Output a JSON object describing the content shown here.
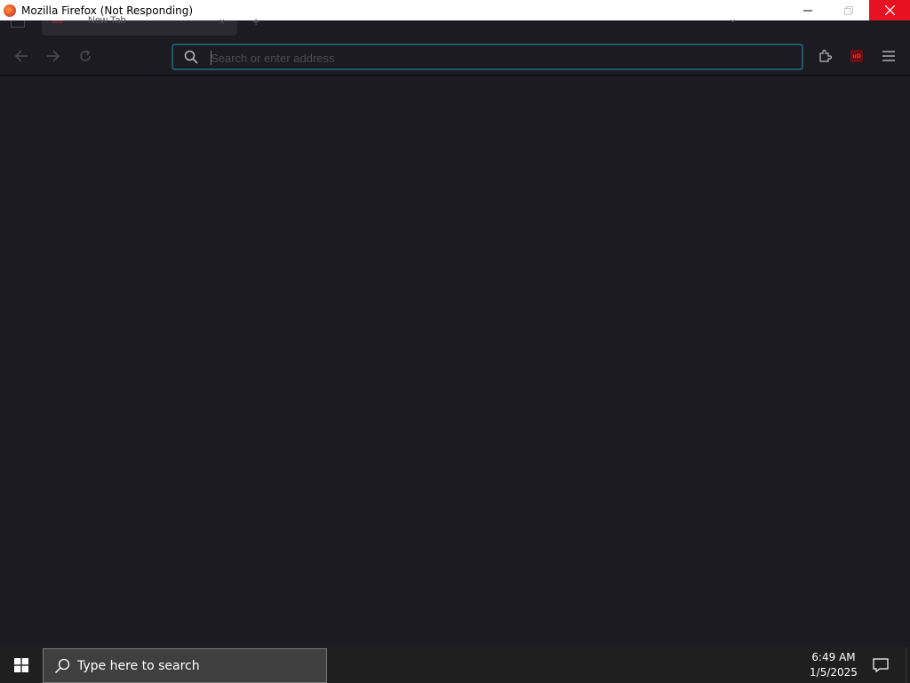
{
  "window": {
    "title": "Mozilla Firefox (Not Responding)",
    "controls": [
      "minimize-icon",
      "restore-icon",
      "close-icon"
    ],
    "close_color": "#e81123"
  },
  "browser": {
    "tab": {
      "label": "New Tab",
      "close": "×"
    },
    "new_tab_glyph": "+",
    "tablist_glyph": "⌄",
    "nav": {
      "back_icon": "arrow-left-icon",
      "forward_icon": "arrow-right-icon",
      "reload_icon": "reload-icon"
    },
    "urlbar": {
      "placeholder": "Search or enter address",
      "value": "",
      "focus_border": "#1d5a6e"
    },
    "toolbar": {
      "extensions_icon": "puzzle-icon",
      "ublock_label": "uO",
      "menu_icon": "hamburger-icon"
    },
    "background": "#1c1b22"
  },
  "taskbar": {
    "search_placeholder": "Type here to search",
    "time": "6:49 AM",
    "date": "1/5/2025",
    "start_icon": "windows-logo-icon",
    "notification_icon": "action-center-icon"
  }
}
